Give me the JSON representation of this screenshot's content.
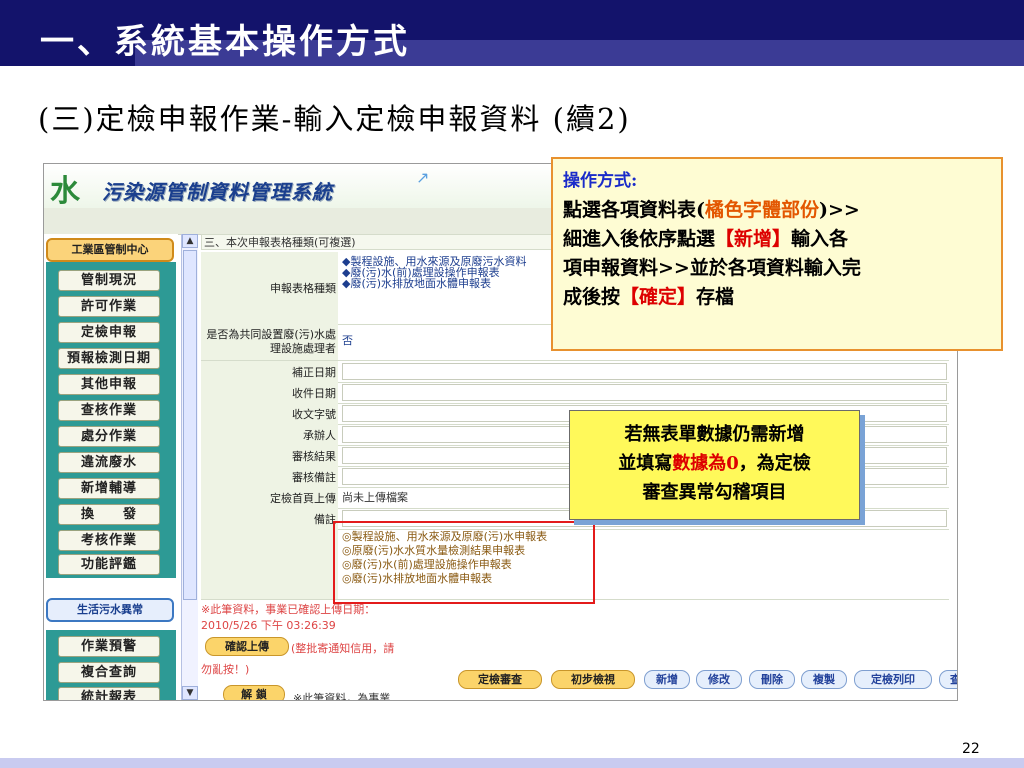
{
  "slide": {
    "title": "一、系統基本操作方式",
    "subtitle": "(三)定檢申報作業-輸入定檢申報資料 (續2)",
    "page_number": "22"
  },
  "app": {
    "logo_mark": "水",
    "logo_text": "污染源管制資料管理系統",
    "nav": {
      "group1_header": "工業區管制中心",
      "items": [
        "管制現況",
        "許可作業",
        "定檢申報",
        "預報檢測日期",
        "其他申報",
        "查核作業",
        "處分作業",
        "違流廢水",
        "新增輔導",
        "換　　發",
        "考核作業",
        "功能評鑑"
      ],
      "group2_header": "生活污水異常",
      "items2": [
        "作業預警",
        "複合查詢",
        "統計報表"
      ]
    },
    "form": {
      "section_title": "三、本次申報表格種類(可複選)",
      "report_type_label": "申報表格種類",
      "report_type_options": [
        "◆製程設施、用水來源及原廢污水資料",
        "◆廢(污)水(前)處理設操作申報表",
        "◆廢(污)水排放地面水體申報表"
      ],
      "shared_facility_label": "是否為共同設置廢(污)水處理設施處理者",
      "shared_facility_value": "否",
      "rows": [
        {
          "label": "補正日期",
          "value": ""
        },
        {
          "label": "收件日期",
          "value": ""
        },
        {
          "label": "收文字號",
          "value": ""
        },
        {
          "label": "承辦人",
          "value": ""
        },
        {
          "label": "審核結果",
          "value": ""
        },
        {
          "label": "審核備註",
          "value": ""
        },
        {
          "label": "定檢首頁上傳",
          "value": "尚未上傳檔案"
        },
        {
          "label": "備註",
          "value": ""
        }
      ],
      "table_links": [
        "◎製程設施、用水來源及原廢(污)水申報表",
        "◎原廢(污)水水質水量檢測結果申報表",
        "◎廢(污)水(前)處理設施操作申報表",
        "◎廢(污)水排放地面水體申報表"
      ],
      "confirm_note_line1": "※此筆資料，事業已確認上傳日期：",
      "confirm_note_line2": "2010/5/26 下午 03:26:39",
      "confirm_upload_button": "確認上傳",
      "confirm_upload_note": "(整批寄通知信用，請",
      "confirm_upload_note2": "勿亂按！)",
      "unlock_button": "解 鎖",
      "unlock_note": "※此筆資料，為事業",
      "buttons": {
        "review": "定檢審查",
        "initial_check": "初步檢視",
        "add": "新增",
        "edit": "修改",
        "delete": "刪除",
        "copy": "複製",
        "print": "定檢列印",
        "query": "查詢"
      }
    }
  },
  "callouts": {
    "operation": {
      "heading": "操作方式:",
      "line1_a": "點選各項資料表(",
      "line1_b": "橘色字體部份",
      "line1_c": ")>>",
      "line2_a": "細進入後依序點選",
      "line2_b": "【新增】",
      "line2_c": "輸入各",
      "line3": "項申報資料>>並於各項資料輸入完",
      "line4_a": "成後按",
      "line4_b": "【確定】",
      "line4_c": "存檔"
    },
    "note": {
      "line1": "若無表單數據仍需新增",
      "line2_a": "並填寫",
      "line2_b": "數據為0",
      "line2_c": "，為定檢",
      "line3": "審查異常勾稽項目"
    }
  },
  "colors": {
    "title_bar": "#13136b",
    "callout_border": "#e8912e",
    "highlight_box": "#e31b1b",
    "note_bg": "#fff95a"
  }
}
